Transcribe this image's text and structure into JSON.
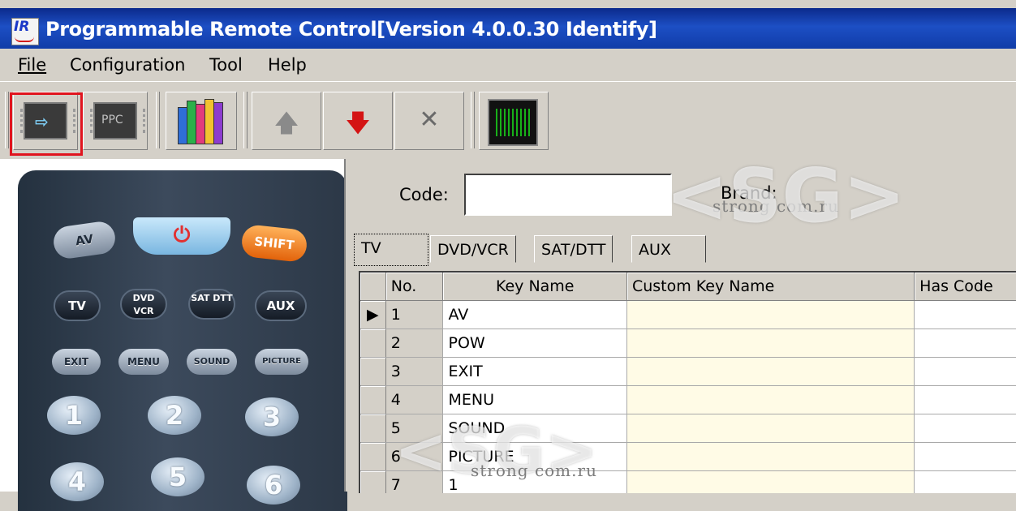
{
  "window": {
    "title": "Programmable Remote Control[Version 4.0.0.30 Identify]",
    "icon": "ir-app-icon"
  },
  "menu": [
    {
      "label": "File"
    },
    {
      "label": "Configuration"
    },
    {
      "label": "Tool"
    },
    {
      "label": "Help"
    }
  ],
  "toolbar": {
    "buttons": [
      {
        "name": "read-from-remote",
        "icon": "chip-arrow-icon"
      },
      {
        "name": "ppc",
        "label": "PPC",
        "icon": "chip-icon"
      },
      {
        "name": "library",
        "icon": "books-icon"
      },
      {
        "name": "move-up",
        "icon": "arrow-up-icon"
      },
      {
        "name": "move-down",
        "icon": "arrow-down-icon"
      },
      {
        "name": "delete",
        "icon": "x-icon"
      },
      {
        "name": "waveform",
        "icon": "oscilloscope-icon"
      }
    ],
    "selected_button": "read-from-remote"
  },
  "remote": {
    "row1": {
      "av": "AV",
      "power": "⏻",
      "shift": "SHIFT"
    },
    "row2": {
      "tv": "TV",
      "dvd_vcr": "DVD VCR",
      "sat_dtt": "SAT DTT",
      "aux": "AUX"
    },
    "row3": {
      "exit": "EXIT",
      "menu": "MENU",
      "sound": "SOUND",
      "picture": "PICTURE"
    },
    "numbers": [
      "1",
      "2",
      "3",
      "4",
      "5",
      "6"
    ]
  },
  "code": {
    "label": "Code:",
    "value": ""
  },
  "brand": {
    "label": "Brand:",
    "value": "strong com.ru"
  },
  "watermark": {
    "text": "<SG>",
    "sub": "strong com.ru"
  },
  "tabs": [
    {
      "label": "TV",
      "active": true
    },
    {
      "label": "DVD/VCR",
      "active": false
    },
    {
      "label": "SAT/DTT",
      "active": false
    },
    {
      "label": "AUX",
      "active": false
    }
  ],
  "grid": {
    "columns": [
      "No.",
      "Key Name",
      "Custom Key Name",
      "Has Code"
    ],
    "current_row_indicator": "▶",
    "rows": [
      {
        "no": "1",
        "key": "AV",
        "custom": ""
      },
      {
        "no": "2",
        "key": "POW",
        "custom": ""
      },
      {
        "no": "3",
        "key": "EXIT",
        "custom": ""
      },
      {
        "no": "4",
        "key": "MENU",
        "custom": ""
      },
      {
        "no": "5",
        "key": "SOUND",
        "custom": ""
      },
      {
        "no": "6",
        "key": "PICTURE",
        "custom": ""
      },
      {
        "no": "7",
        "key": "1",
        "custom": ""
      }
    ]
  }
}
